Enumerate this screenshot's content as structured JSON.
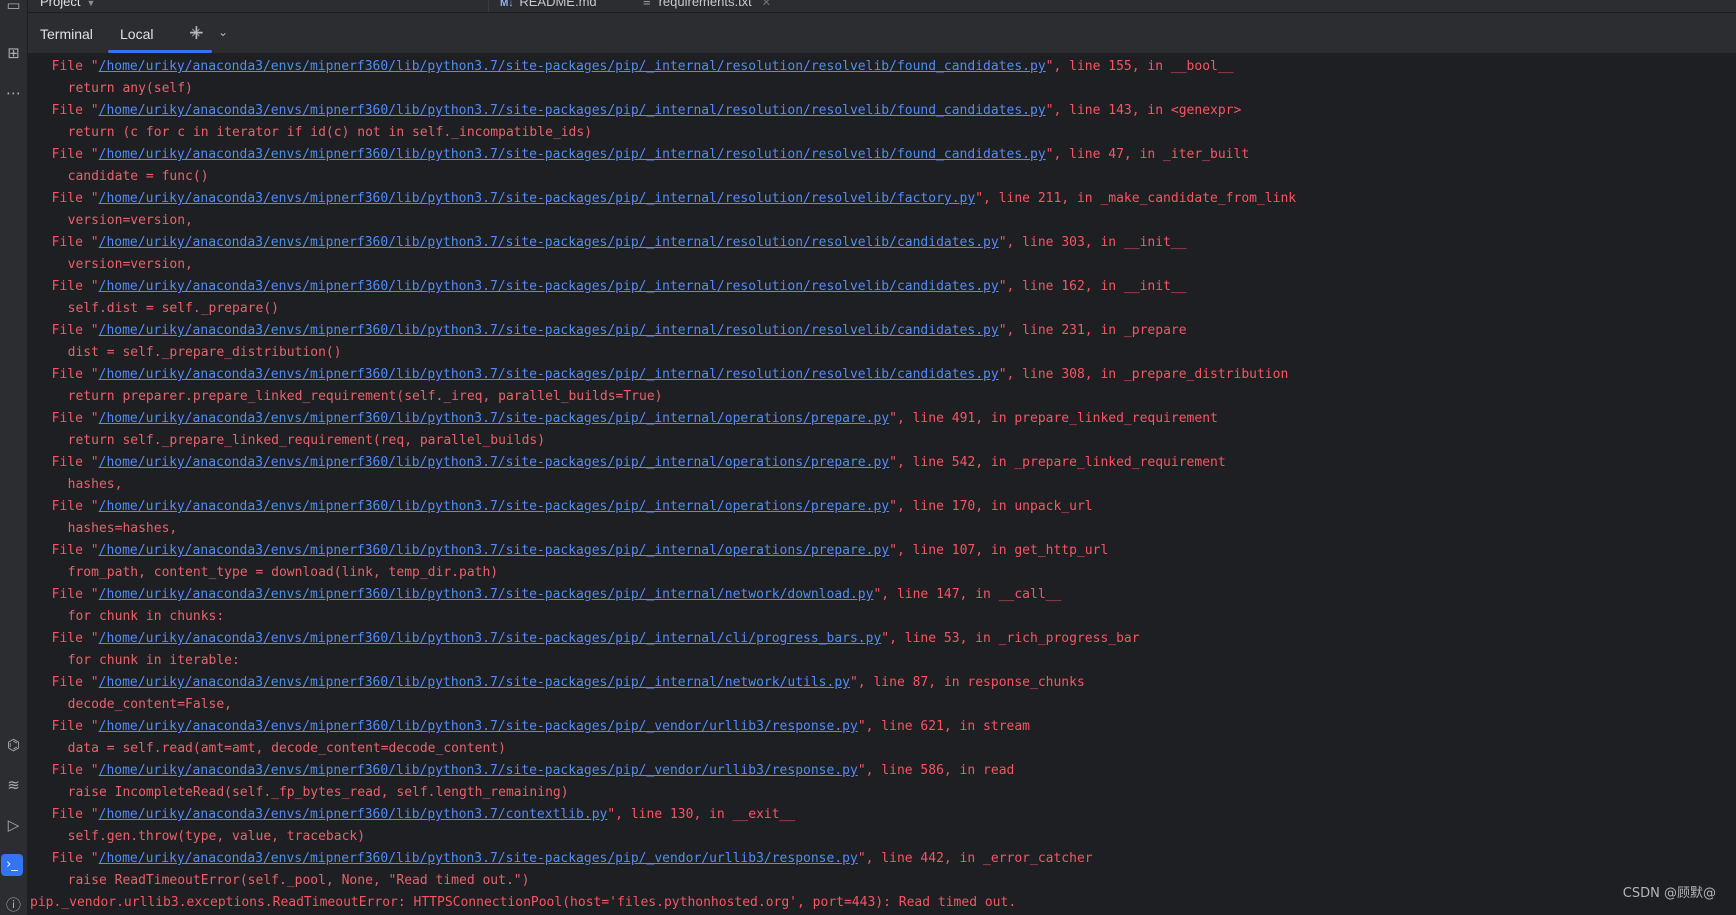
{
  "project_menu": {
    "label": "Project"
  },
  "editor_tabs": [
    {
      "label": "README.md",
      "icon": "M↓"
    },
    {
      "label": "requirements.txt",
      "icon": "≡"
    }
  ],
  "terminal": {
    "title": "Terminal",
    "tab_label": "Local",
    "add_tooltip_icon": "plus-icon"
  },
  "traceback": [
    {
      "type": "file",
      "path": "/home/uriky/anaconda3/envs/mipnerf360/lib/python3.7/site-packages/pip/_internal/resolution/resolvelib/found_candidates.py",
      "suffix": "\", line 155, in __bool__"
    },
    {
      "type": "code",
      "text": "  return any(self)"
    },
    {
      "type": "file",
      "path": "/home/uriky/anaconda3/envs/mipnerf360/lib/python3.7/site-packages/pip/_internal/resolution/resolvelib/found_candidates.py",
      "suffix": "\", line 143, in <genexpr>"
    },
    {
      "type": "code",
      "text": "  return (c for c in iterator if id(c) not in self._incompatible_ids)"
    },
    {
      "type": "file",
      "path": "/home/uriky/anaconda3/envs/mipnerf360/lib/python3.7/site-packages/pip/_internal/resolution/resolvelib/found_candidates.py",
      "suffix": "\", line 47, in _iter_built"
    },
    {
      "type": "code",
      "text": "  candidate = func()"
    },
    {
      "type": "file",
      "path": "/home/uriky/anaconda3/envs/mipnerf360/lib/python3.7/site-packages/pip/_internal/resolution/resolvelib/factory.py",
      "suffix": "\", line 211, in _make_candidate_from_link"
    },
    {
      "type": "code",
      "text": "  version=version,"
    },
    {
      "type": "file",
      "path": "/home/uriky/anaconda3/envs/mipnerf360/lib/python3.7/site-packages/pip/_internal/resolution/resolvelib/candidates.py",
      "suffix": "\", line 303, in __init__"
    },
    {
      "type": "code",
      "text": "  version=version,"
    },
    {
      "type": "file",
      "path": "/home/uriky/anaconda3/envs/mipnerf360/lib/python3.7/site-packages/pip/_internal/resolution/resolvelib/candidates.py",
      "suffix": "\", line 162, in __init__"
    },
    {
      "type": "code",
      "text": "  self.dist = self._prepare()"
    },
    {
      "type": "file",
      "path": "/home/uriky/anaconda3/envs/mipnerf360/lib/python3.7/site-packages/pip/_internal/resolution/resolvelib/candidates.py",
      "suffix": "\", line 231, in _prepare"
    },
    {
      "type": "code",
      "text": "  dist = self._prepare_distribution()"
    },
    {
      "type": "file",
      "path": "/home/uriky/anaconda3/envs/mipnerf360/lib/python3.7/site-packages/pip/_internal/resolution/resolvelib/candidates.py",
      "suffix": "\", line 308, in _prepare_distribution"
    },
    {
      "type": "code",
      "text": "  return preparer.prepare_linked_requirement(self._ireq, parallel_builds=True)"
    },
    {
      "type": "file",
      "path": "/home/uriky/anaconda3/envs/mipnerf360/lib/python3.7/site-packages/pip/_internal/operations/prepare.py",
      "suffix": "\", line 491, in prepare_linked_requirement"
    },
    {
      "type": "code",
      "text": "  return self._prepare_linked_requirement(req, parallel_builds)"
    },
    {
      "type": "file",
      "path": "/home/uriky/anaconda3/envs/mipnerf360/lib/python3.7/site-packages/pip/_internal/operations/prepare.py",
      "suffix": "\", line 542, in _prepare_linked_requirement"
    },
    {
      "type": "code",
      "text": "  hashes,"
    },
    {
      "type": "file",
      "path": "/home/uriky/anaconda3/envs/mipnerf360/lib/python3.7/site-packages/pip/_internal/operations/prepare.py",
      "suffix": "\", line 170, in unpack_url"
    },
    {
      "type": "code",
      "text": "  hashes=hashes,"
    },
    {
      "type": "file",
      "path": "/home/uriky/anaconda3/envs/mipnerf360/lib/python3.7/site-packages/pip/_internal/operations/prepare.py",
      "suffix": "\", line 107, in get_http_url"
    },
    {
      "type": "code",
      "text": "  from_path, content_type = download(link, temp_dir.path)"
    },
    {
      "type": "file",
      "path": "/home/uriky/anaconda3/envs/mipnerf360/lib/python3.7/site-packages/pip/_internal/network/download.py",
      "suffix": "\", line 147, in __call__"
    },
    {
      "type": "code",
      "text": "  for chunk in chunks:"
    },
    {
      "type": "file",
      "path": "/home/uriky/anaconda3/envs/mipnerf360/lib/python3.7/site-packages/pip/_internal/cli/progress_bars.py",
      "suffix": "\", line 53, in _rich_progress_bar"
    },
    {
      "type": "code",
      "text": "  for chunk in iterable:"
    },
    {
      "type": "file",
      "path": "/home/uriky/anaconda3/envs/mipnerf360/lib/python3.7/site-packages/pip/_internal/network/utils.py",
      "suffix": "\", line 87, in response_chunks"
    },
    {
      "type": "code",
      "text": "  decode_content=False,"
    },
    {
      "type": "file",
      "path": "/home/uriky/anaconda3/envs/mipnerf360/lib/python3.7/site-packages/pip/_vendor/urllib3/response.py",
      "suffix": "\", line 621, in stream"
    },
    {
      "type": "code",
      "text": "  data = self.read(amt=amt, decode_content=decode_content)"
    },
    {
      "type": "file",
      "path": "/home/uriky/anaconda3/envs/mipnerf360/lib/python3.7/site-packages/pip/_vendor/urllib3/response.py",
      "suffix": "\", line 586, in read"
    },
    {
      "type": "code",
      "text": "  raise IncompleteRead(self._fp_bytes_read, self.length_remaining)"
    },
    {
      "type": "file",
      "path": "/home/uriky/anaconda3/envs/mipnerf360/lib/python3.7/contextlib.py",
      "suffix": "\", line 130, in __exit__"
    },
    {
      "type": "code",
      "text": "  self.gen.throw(type, value, traceback)"
    },
    {
      "type": "file",
      "path": "/home/uriky/anaconda3/envs/mipnerf360/lib/python3.7/site-packages/pip/_vendor/urllib3/response.py",
      "suffix": "\", line 442, in _error_catcher"
    },
    {
      "type": "code",
      "text": "  raise ReadTimeoutError(self._pool, None, \"Read timed out.\")"
    },
    {
      "type": "error",
      "text": "pip._vendor.urllib3.exceptions.ReadTimeoutError: HTTPSConnectionPool(host='files.pythonhosted.org', port=443): Read timed out."
    }
  ],
  "file_prefix": "  File \"",
  "watermark": "CSDN @顾默@",
  "colors": {
    "error_text": "#f75464",
    "link": "#548af7",
    "accent": "#3574f0",
    "background": "#1e1f22",
    "panel": "#2b2d30"
  }
}
